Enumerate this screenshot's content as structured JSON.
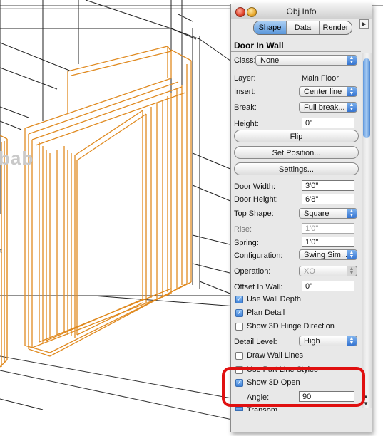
{
  "canvas": {
    "ghost_label": "bab",
    "mark": "t"
  },
  "palette": {
    "title": "Obj Info",
    "tabs": [
      "Shape",
      "Data",
      "Render"
    ],
    "active_tab": "Shape",
    "object_title": "Door In Wall",
    "class_label": "Class:",
    "class_value": "None",
    "layer_label": "Layer:",
    "layer_value": "Main Floor",
    "insert_label": "Insert:",
    "insert_value": "Center line",
    "break_label": "Break:",
    "break_value": "Full break...",
    "height_label": "Height:",
    "height_value": "0\"",
    "flip_label": "Flip",
    "set_position_label": "Set Position...",
    "settings_label": "Settings...",
    "door_width_label": "Door Width:",
    "door_width_value": "3'0\"",
    "door_height_label": "Door Height:",
    "door_height_value": "6'8\"",
    "top_shape_label": "Top Shape:",
    "top_shape_value": "Square",
    "rise_label": "Rise:",
    "rise_value": "1'0\"",
    "spring_label": "Spring:",
    "spring_value": "1'0\"",
    "configuration_label": "Configuration:",
    "configuration_value": "Swing Sim...",
    "operation_label": "Operation:",
    "operation_value": "XO",
    "offset_label": "Offset In Wall:",
    "offset_value": "0\"",
    "use_wall_depth_label": "Use Wall Depth",
    "plan_detail_label": "Plan Detail",
    "show_hinge_label": "Show 3D Hinge Direction",
    "detail_level_label": "Detail Level:",
    "detail_level_value": "High",
    "draw_wall_lines_label": "Draw Wall Lines",
    "use_part_line_label": "Use Part Line Styles",
    "show_3d_open_label": "Show 3D Open",
    "angle_label": "Angle:",
    "angle_value": "90",
    "transom_label": "Transom"
  },
  "colors": {
    "door_wireframe": "#e08a20",
    "highlight": "#e01010",
    "accent": "#3f82d9"
  }
}
